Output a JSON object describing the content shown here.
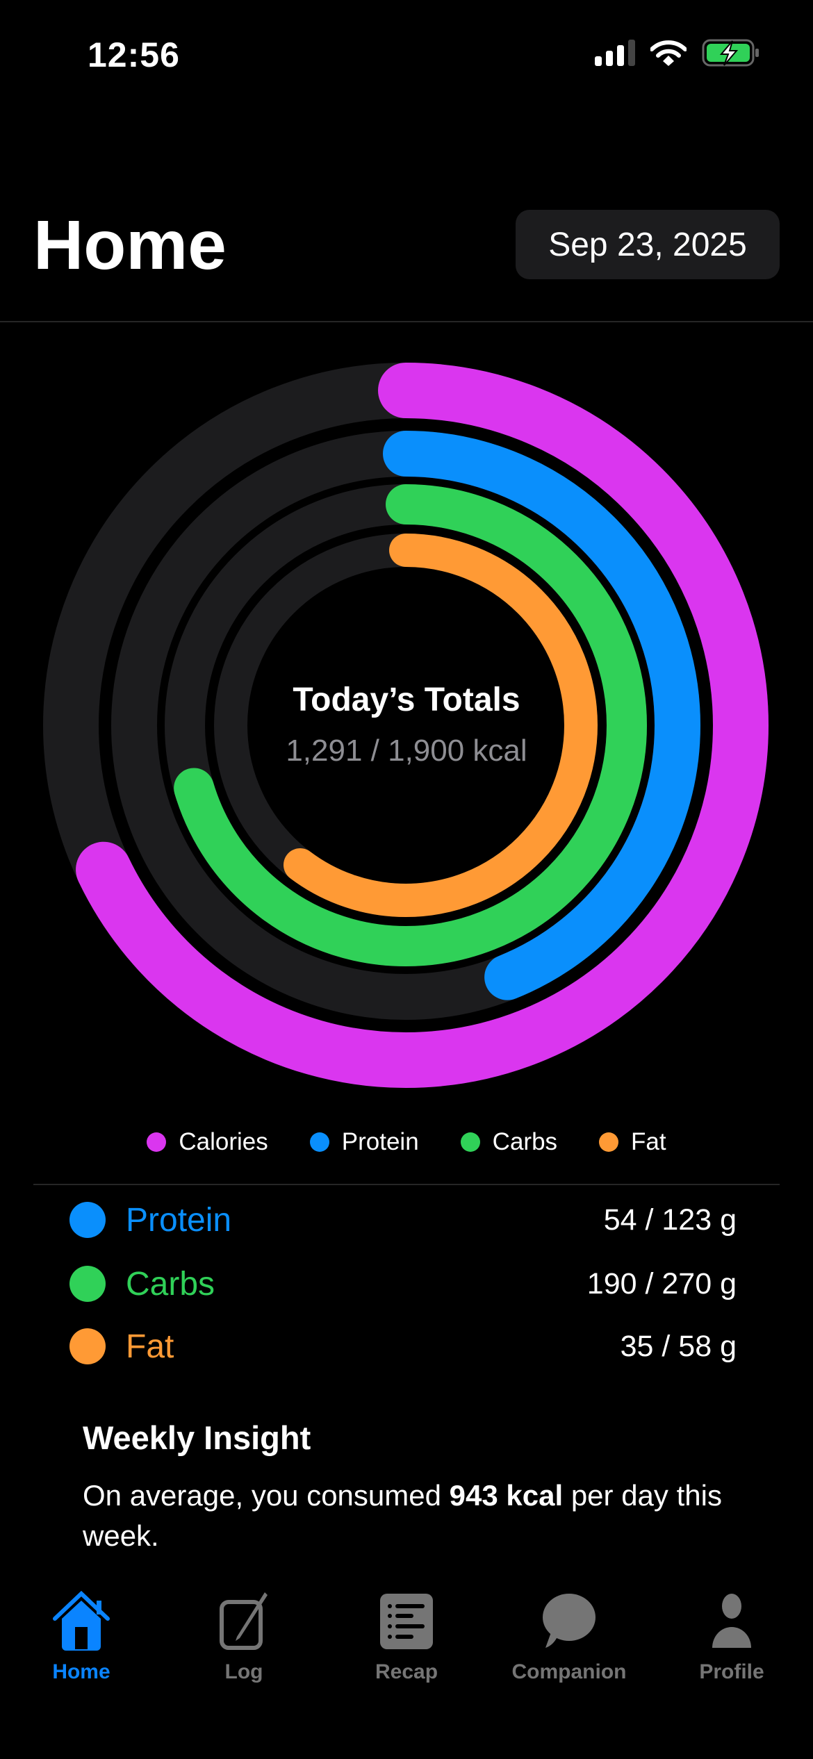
{
  "status": {
    "time": "12:56"
  },
  "header": {
    "title": "Home",
    "date": "Sep 23, 2025"
  },
  "summary": {
    "title": "Today’s Totals",
    "subtitle": "1,291 / 1,900 kcal"
  },
  "colors": {
    "calories": "#da36ef",
    "protein": "#0a8ffc",
    "carbs": "#30d158",
    "fat": "#ff9a35",
    "track": "#1c1c1e"
  },
  "rings": [
    {
      "name": "Calories",
      "progress": 0.679
    },
    {
      "name": "Protein",
      "progress": 0.439
    },
    {
      "name": "Carbs",
      "progress": 0.704
    },
    {
      "name": "Fat",
      "progress": 0.603
    }
  ],
  "legend": [
    "Calories",
    "Protein",
    "Carbs",
    "Fat"
  ],
  "macros": [
    {
      "label": "Protein",
      "value": "54 / 123 g"
    },
    {
      "label": "Carbs",
      "value": "190 / 270 g"
    },
    {
      "label": "Fat",
      "value": "35 / 58 g"
    }
  ],
  "insight": {
    "title": "Weekly Insight",
    "prefix": "On average, you consumed ",
    "highlight": "943 kcal",
    "suffix": " per day this week."
  },
  "tabs": [
    "Home",
    "Log",
    "Recap",
    "Companion",
    "Profile"
  ]
}
